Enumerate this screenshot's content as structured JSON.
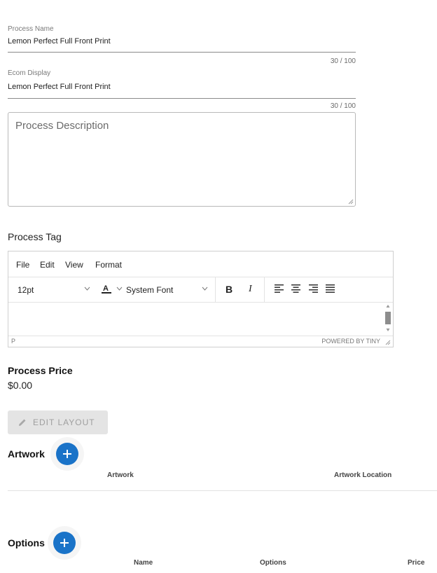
{
  "process_name": {
    "label": "Process Name",
    "value": "Lemon Perfect Full Front Print",
    "counter": "30 / 100"
  },
  "ecom_display": {
    "label": "Ecom Display",
    "value": "Lemon Perfect Full Front Print",
    "counter": "30 / 100"
  },
  "process_description": {
    "placeholder": "Process Description"
  },
  "process_tag": {
    "title": "Process Tag",
    "menu": [
      "File",
      "Edit",
      "View",
      "Format"
    ],
    "font_size": "12pt",
    "font_family": "System Font",
    "bold_label": "B",
    "italic_label": "I",
    "path": "P",
    "powered_by": "POWERED BY TINY"
  },
  "process_price": {
    "title": "Process Price",
    "value": "$0.00"
  },
  "edit_layout_label": "EDIT LAYOUT",
  "artwork": {
    "title": "Artwork",
    "columns": [
      "Artwork",
      "Artwork Location"
    ]
  },
  "options": {
    "title": "Options",
    "columns": [
      "Name",
      "Options",
      "Price"
    ]
  },
  "colors": {
    "accent": "#1a73c8",
    "disabled_bg": "#e4e4e4",
    "disabled_text": "#9f9f9f"
  }
}
